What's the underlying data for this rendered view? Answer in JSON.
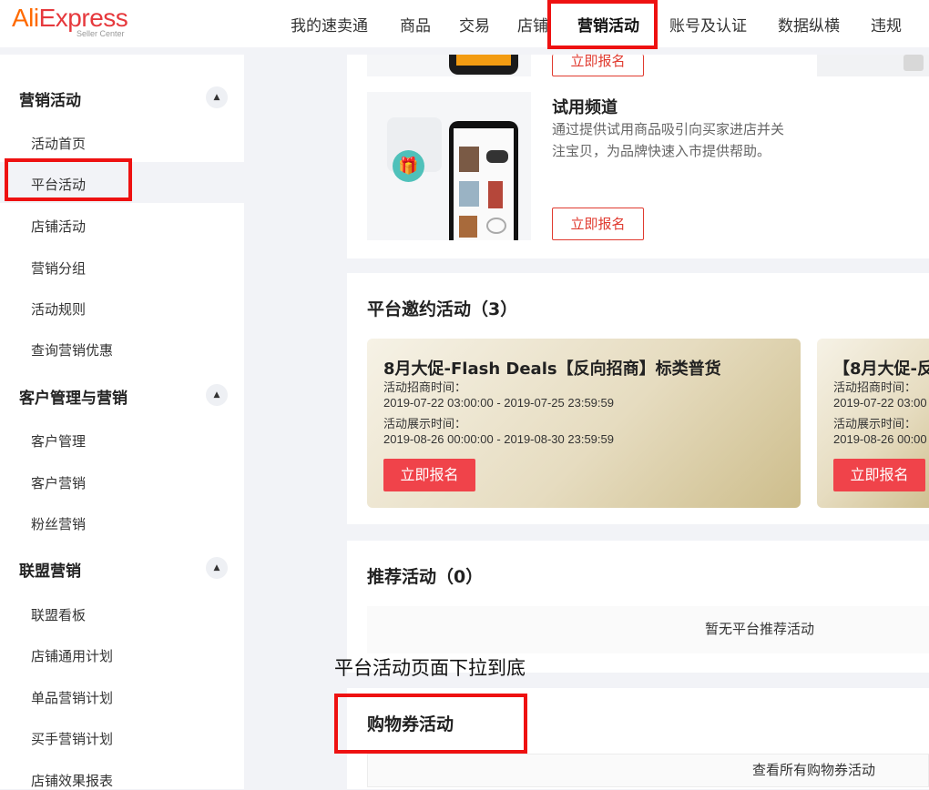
{
  "logo": {
    "brand_part1": "Ali",
    "brand_part2": "Express",
    "subtitle": "Seller Center"
  },
  "nav": [
    {
      "label": "我的速卖通"
    },
    {
      "label": "商品"
    },
    {
      "label": "交易"
    },
    {
      "label": "店铺"
    },
    {
      "label": "营销活动",
      "active": true
    },
    {
      "label": "账号及认证"
    },
    {
      "label": "数据纵横"
    },
    {
      "label": "违规"
    }
  ],
  "sidebar": {
    "sections": [
      {
        "title": "营销活动",
        "items": [
          "活动首页",
          "平台活动",
          "店铺活动",
          "营销分组",
          "活动规则",
          "查询营销优惠"
        ]
      },
      {
        "title": "客户管理与营销",
        "items": [
          "客户管理",
          "客户营销",
          "粉丝营销"
        ]
      },
      {
        "title": "联盟营销",
        "items": [
          "联盟看板",
          "店铺通用计划",
          "单品营销计划",
          "买手营销计划",
          "店铺效果报表"
        ]
      }
    ],
    "active_item": "平台活动",
    "collapse_glyph": "▲"
  },
  "channels": {
    "signup_label": "立即报名",
    "trial": {
      "title": "试用频道",
      "desc_line1": "通过提供试用商品吸引向买家进店并关",
      "desc_line2": "注宝贝，为品牌快速入市提供帮助。"
    }
  },
  "invite": {
    "title": "平台邀约活动（3）",
    "cards": [
      {
        "title": "8月大促-Flash Deals【反向招商】标类普货",
        "recruit_label": "活动招商时间：",
        "recruit_time": "2019-07-22 03:00:00 - 2019-07-25 23:59:59",
        "display_label": "活动展示时间：",
        "display_time": "2019-08-26 00:00:00 - 2019-08-30 23:59:59",
        "button": "立即报名"
      },
      {
        "title": "【8月大促-反",
        "recruit_label": "活动招商时间：",
        "recruit_time": "2019-07-22 03:00",
        "display_label": "活动展示时间：",
        "display_time": "2019-08-26 00:00",
        "button": "立即报名"
      }
    ]
  },
  "recommend": {
    "title": "推荐活动（0）",
    "empty_text": "暂无平台推荐活动"
  },
  "caption": "平台活动页面下拉到底",
  "coupon": {
    "title": "购物券活动",
    "view_all": "查看所有购物券活动"
  },
  "colors": {
    "highlight": "#ee1111",
    "accent": "#f0434a",
    "brand_orange": "#ff6a00"
  }
}
